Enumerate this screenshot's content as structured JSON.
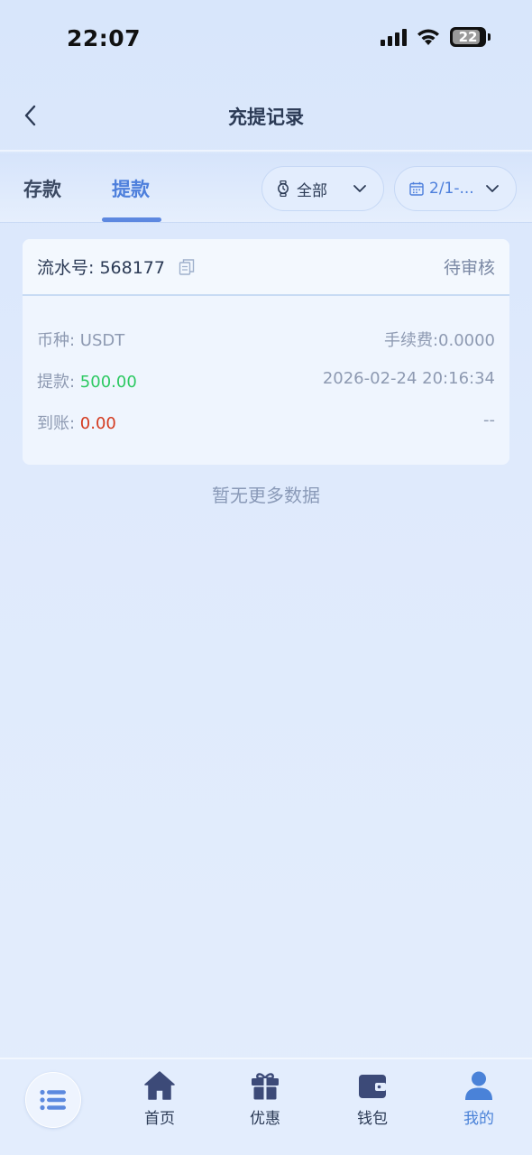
{
  "status_bar": {
    "time": "22:07",
    "battery": "22"
  },
  "header": {
    "title": "充提记录"
  },
  "tabs": [
    {
      "label": "存款",
      "active": false
    },
    {
      "label": "提款",
      "active": true
    }
  ],
  "filters": {
    "status": {
      "label": "全部"
    },
    "date": {
      "label": "2/1-..."
    }
  },
  "record": {
    "serial_label": "流水号: 568177",
    "status": "待审核",
    "currency_label": "币种: USDT",
    "fee_label": "手续费:0.0000",
    "withdraw_label": "提款: ",
    "withdraw_value": "500.00",
    "timestamp": "2026-02-24 20:16:34",
    "received_label": "到账: ",
    "received_value": "0.00",
    "received_time": "--"
  },
  "no_more_text": "暂无更多数据",
  "bottom_nav": {
    "items": [
      {
        "label": "首页"
      },
      {
        "label": "优惠"
      },
      {
        "label": "钱包"
      },
      {
        "label": "我的"
      }
    ]
  },
  "colors": {
    "accent": "#4d7fdc",
    "success": "#2ec963",
    "danger": "#d43a1f"
  }
}
